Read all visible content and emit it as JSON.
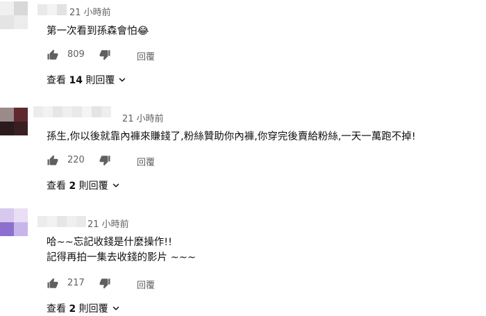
{
  "comments": [
    {
      "time": "21 小時前",
      "lines": [
        "第一次看到孫森會怕😂"
      ],
      "likes": "809",
      "reply_label": "回覆",
      "view_prefix": "查看 ",
      "view_count": "14",
      "view_suffix": " 則回覆"
    },
    {
      "time": "21 小時前",
      "lines": [
        "孫生,你以後就靠內褲來賺錢了,粉絲贊助你內褲,你穿完後賣給粉絲,一天一萬跑不掉!"
      ],
      "likes": "220",
      "reply_label": "回覆",
      "view_prefix": "查看 ",
      "view_count": "2",
      "view_suffix": " 則回覆"
    },
    {
      "time": "21 小時前",
      "lines": [
        "哈~~忘記收錢是什麼操作!!",
        "記得再拍一集去收錢的影片 ~~~"
      ],
      "likes": "217",
      "reply_label": "回覆",
      "view_prefix": "查看 ",
      "view_count": "2",
      "view_suffix": " 則回覆"
    }
  ],
  "icons": {
    "like": "thumb-up-icon",
    "dislike": "thumb-down-icon",
    "expand": "chevron-down-icon"
  },
  "colors": {
    "meta_text": "#606060",
    "body_text": "#0f0f0f"
  }
}
